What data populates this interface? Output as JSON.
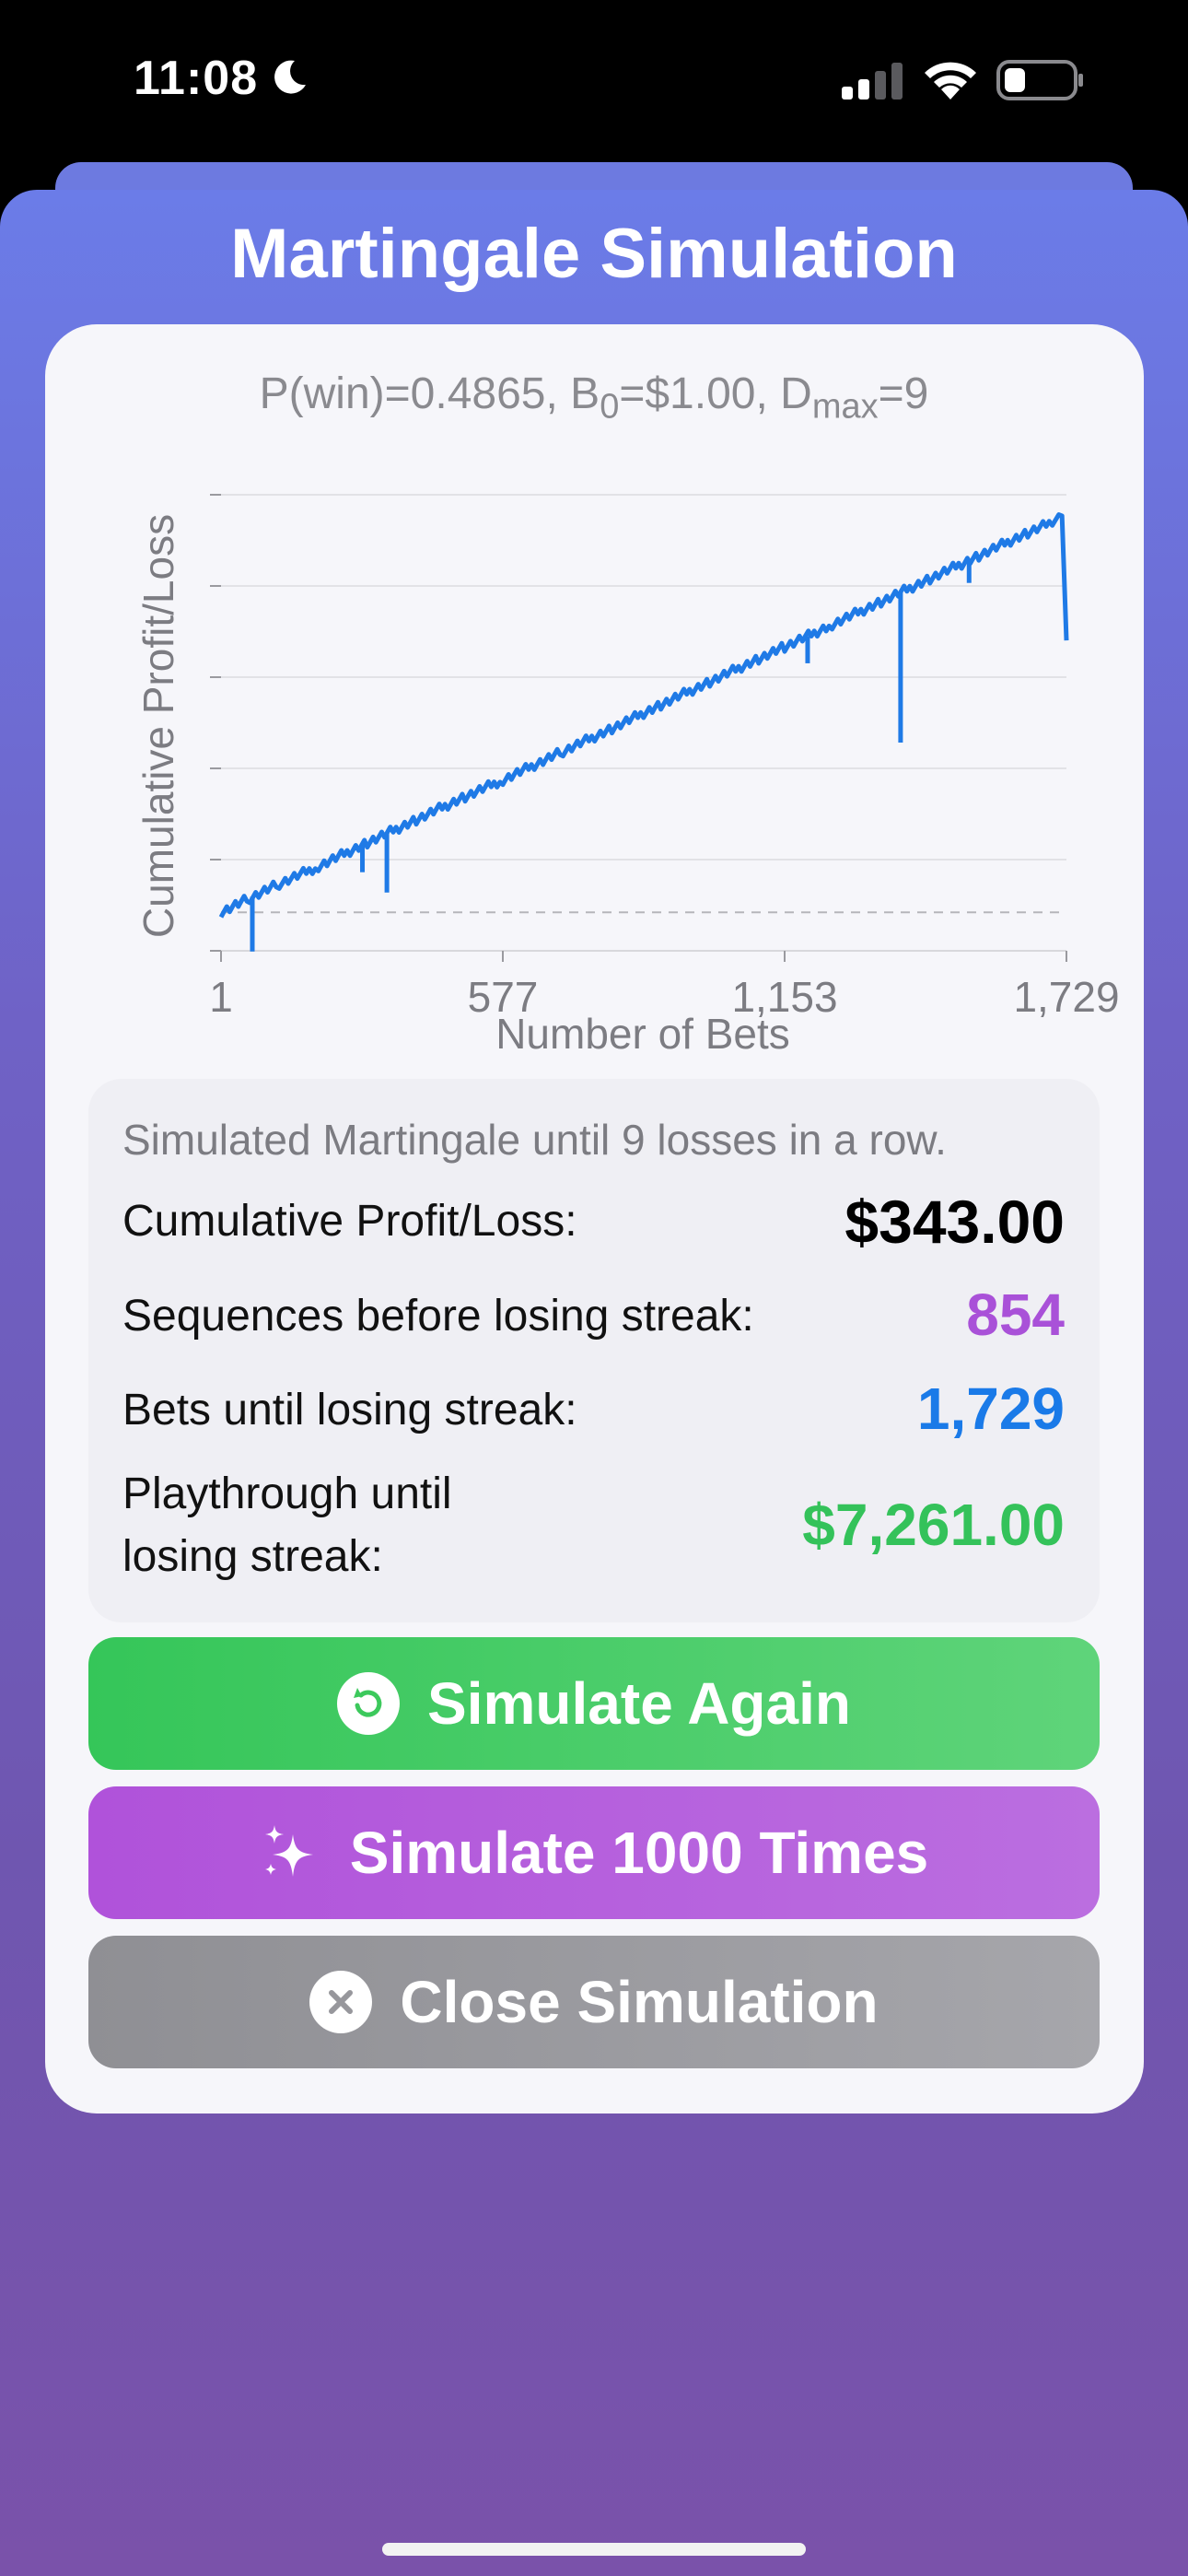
{
  "status_bar": {
    "time": "11:08"
  },
  "screen": {
    "title": "Martingale Simulation"
  },
  "chart_data": {
    "type": "line",
    "title_parts": {
      "p_win": "P(win)=0.4865, B",
      "b_sub": "0",
      "b_val": "=$1.00, D",
      "d_sub": "max",
      "d_val": "=9"
    },
    "xlabel": "Number of Bets",
    "ylabel": "Cumulative Profit/Loss",
    "x_ticks": [
      "1",
      "577",
      "1,153",
      "1,729"
    ],
    "xlim": [
      1,
      1729
    ],
    "series": [
      {
        "color": "#1f7ae6",
        "x": [
          1,
          60,
          120,
          200,
          300,
          400,
          500,
          577,
          700,
          800,
          900,
          1000,
          1100,
          1153,
          1250,
          1350,
          1450,
          1550,
          1650,
          1700,
          1720,
          1729
        ],
        "y": [
          0,
          18,
          36,
          58,
          88,
          117,
          146,
          167,
          203,
          232,
          262,
          291,
          320,
          335,
          363,
          392,
          421,
          450,
          479,
          494,
          500,
          343
        ]
      }
    ],
    "dips": [
      {
        "x": 65,
        "depth": 0.12
      },
      {
        "x": 340,
        "depth": 0.13
      },
      {
        "x": 290,
        "depth": 0.06
      },
      {
        "x": 1390,
        "depth": 0.33
      },
      {
        "x": 1200,
        "depth": 0.06
      },
      {
        "x": 1530,
        "depth": 0.05
      }
    ],
    "break_even_line": true,
    "grid": true
  },
  "stats": {
    "note": "Simulated Martingale until 9 losses in a row.",
    "rows": [
      {
        "label": "Cumulative Profit/Loss:",
        "value": "$343.00",
        "color": "#000000"
      },
      {
        "label": "Sequences before losing streak:",
        "value": "854",
        "color": "#a951d8"
      },
      {
        "label": "Bets until losing streak:",
        "value": "1,729",
        "color": "#1a7ae8"
      },
      {
        "label_line1": "Playthrough until",
        "label_line2": "losing streak:",
        "value": "$7,261.00",
        "color": "#34c25a"
      }
    ]
  },
  "buttons": {
    "simulate_again": "Simulate Again",
    "simulate_1000": "Simulate 1000 Times",
    "close": "Close Simulation"
  },
  "colors": {
    "green": "#3cc95c",
    "purple": "#b359dc",
    "gray": "#97979c"
  }
}
